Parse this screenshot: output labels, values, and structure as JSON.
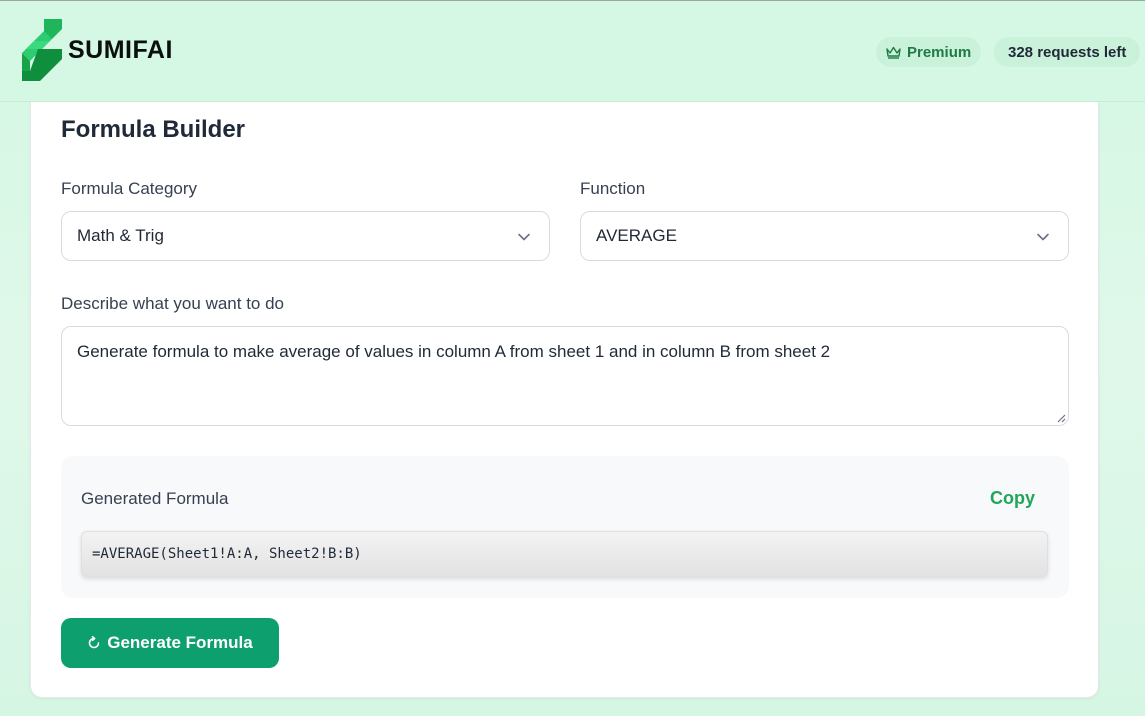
{
  "header": {
    "brand": "SUMIFAI",
    "premium_label": "Premium",
    "requests_label": "328 requests left"
  },
  "colors": {
    "accent": "#0e9f6e",
    "copy_green": "#22a55a",
    "header_bg": "#d4f8e3"
  },
  "builder": {
    "title": "Formula Builder",
    "category_label": "Formula Category",
    "category_value": "Math & Trig",
    "function_label": "Function",
    "function_value": "AVERAGE",
    "describe_label": "Describe what you want to do",
    "describe_value": "Generate formula to make average of values in column A from sheet 1 and in column B from sheet 2",
    "generated_label": "Generated Formula",
    "copy_label": "Copy",
    "formula": "=AVERAGE(Sheet1!A:A, Sheet2!B:B)",
    "generate_label": "Generate Formula"
  },
  "icons": {
    "logo": "sumifai-logo-icon",
    "premium": "crown-icon",
    "chevron": "chevron-down-icon",
    "refresh": "refresh-icon",
    "resize": "resize-handle-icon"
  }
}
